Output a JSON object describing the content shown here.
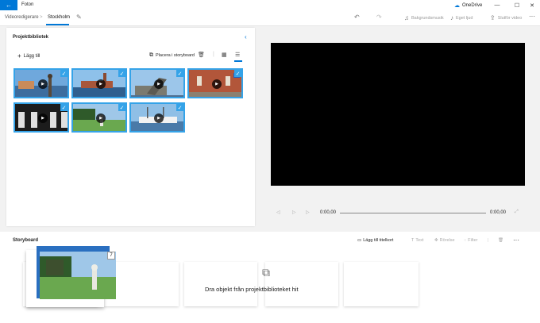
{
  "titlebar": {
    "back_icon": "back-arrow-icon",
    "app_title": "Foton",
    "onedrive_label": "OneDrive",
    "minimize": "—",
    "maximize": "☐",
    "close": "✕"
  },
  "toolbar": {
    "breadcrumb_root": "Videoredigerare",
    "breadcrumb_sep": ">",
    "project_name": "Stockholm",
    "edit_icon": "pencil-icon",
    "undo_icon": "undo-icon",
    "redo_icon": "redo-icon",
    "background_music": "Bakgrundsmusik",
    "custom_audio": "Eget ljud",
    "finish_video": "Slutför video",
    "more": "···"
  },
  "library": {
    "title": "Projektbibliotek",
    "add_label": "Lägg till",
    "place_label": "Placera i storyboard",
    "thumbnails": [
      {
        "name": "thumb-statue-harbor",
        "selected": true
      },
      {
        "name": "thumb-cityhall-water",
        "selected": true
      },
      {
        "name": "thumb-statue-sky",
        "selected": true
      },
      {
        "name": "thumb-brick-courtyard",
        "selected": true
      },
      {
        "name": "thumb-arches-silhouette",
        "selected": true
      },
      {
        "name": "thumb-garden-statue",
        "selected": true
      },
      {
        "name": "thumb-boat-harbor",
        "selected": true
      }
    ]
  },
  "playback": {
    "current_time": "0:00,00",
    "total_time": "0:00,00",
    "progress": 0
  },
  "storyboard": {
    "title": "Storyboard",
    "add_title_card": "Lägg till titelkort",
    "text": "Text",
    "motion": "Rörelse",
    "filters": "Filter",
    "more": "···",
    "drop_hint": "Dra objekt från projektbiblioteket hit",
    "drag_count": "7"
  },
  "colors": {
    "accent": "#0078d7",
    "selection": "#35a3e8"
  }
}
